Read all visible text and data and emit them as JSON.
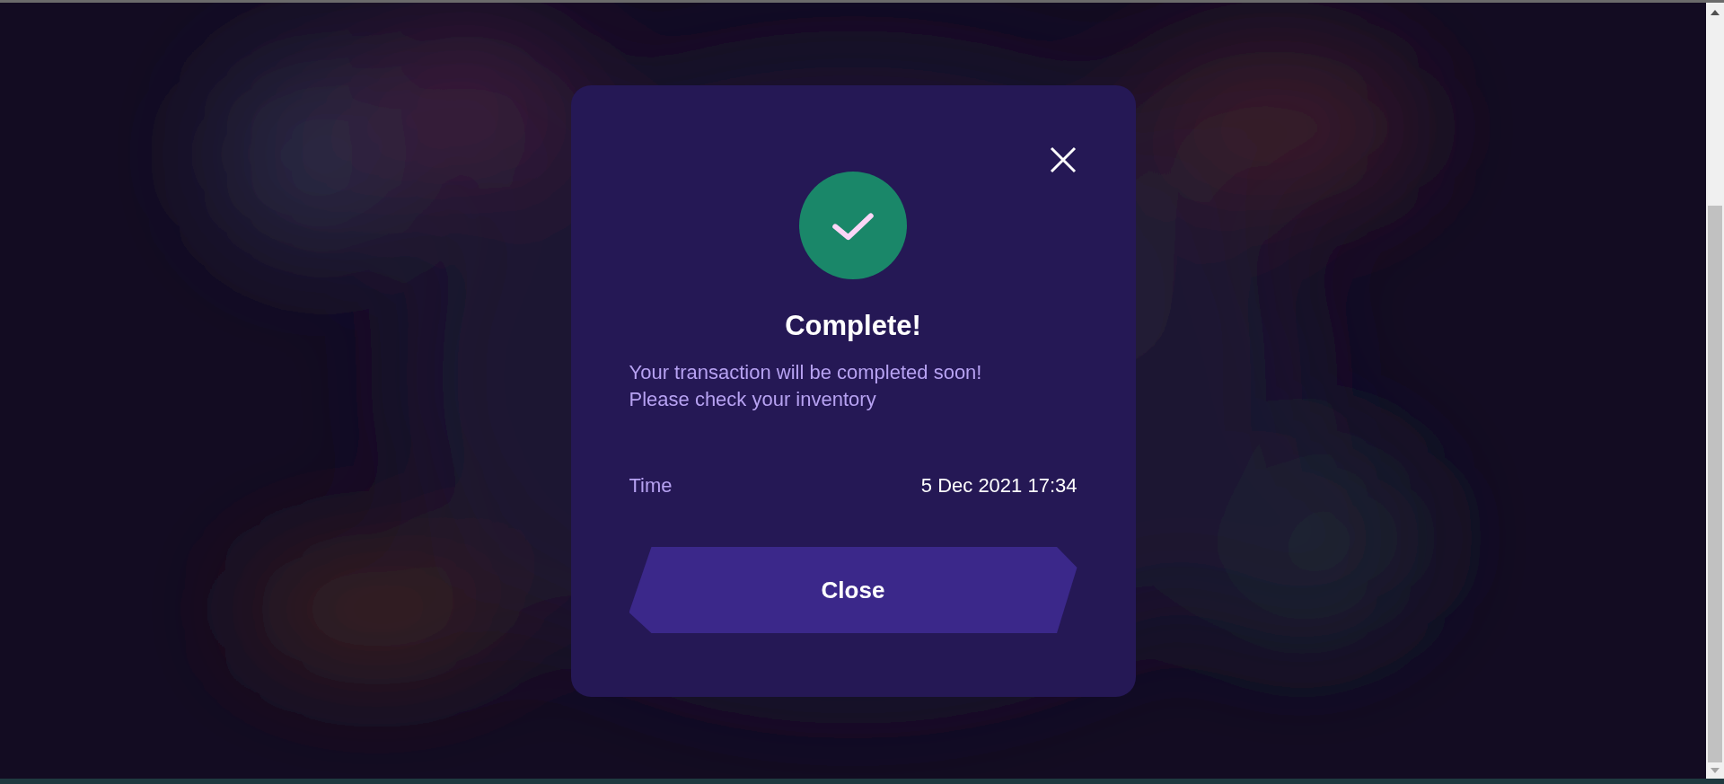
{
  "dialog": {
    "title": "Complete!",
    "message": [
      "Your transaction will be completed soon!",
      "Please check your inventory"
    ],
    "details": [
      {
        "label": "Time",
        "value": "5 Dec 2021 17:34"
      }
    ],
    "button": "Close"
  }
}
